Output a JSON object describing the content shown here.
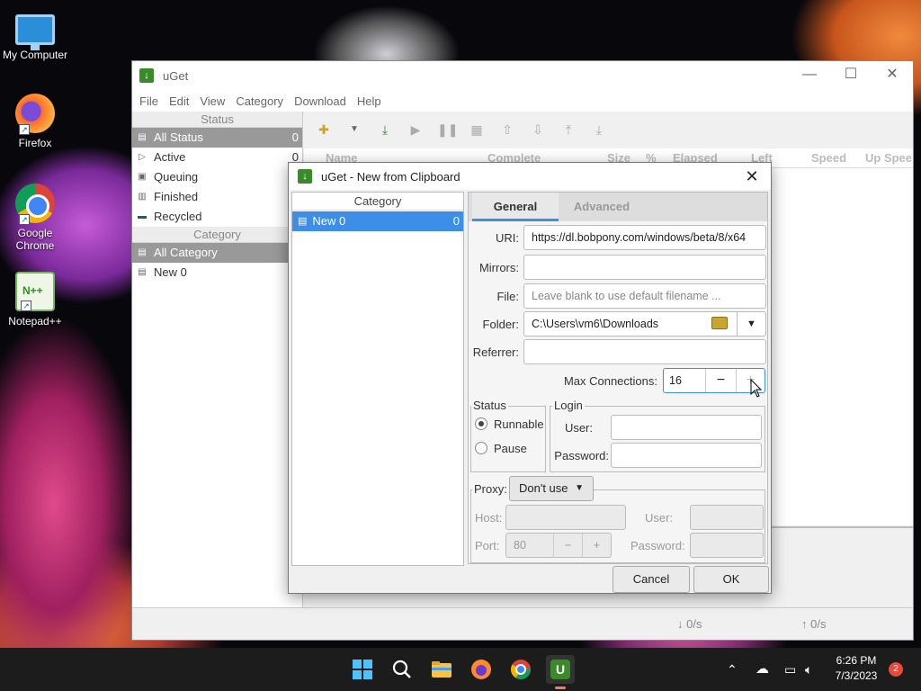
{
  "desktop": {
    "icons": [
      {
        "label": "My Computer"
      },
      {
        "label": "Firefox"
      },
      {
        "label": "Google Chrome"
      },
      {
        "label": "Notepad++"
      }
    ]
  },
  "main_window": {
    "title": "uGet",
    "menu": [
      "File",
      "Edit",
      "View",
      "Category",
      "Download",
      "Help"
    ],
    "status_header": "Status",
    "status_items": [
      {
        "label": "All Status",
        "count": "0"
      },
      {
        "label": "Active",
        "count": "0"
      },
      {
        "label": "Queuing",
        "count": ""
      },
      {
        "label": "Finished",
        "count": ""
      },
      {
        "label": "Recycled",
        "count": ""
      }
    ],
    "category_header": "Category",
    "category_items": [
      {
        "label": "All Category"
      },
      {
        "label": "New 0"
      }
    ],
    "columns": [
      "Name",
      "Complete",
      "Size",
      "%",
      "Elapsed",
      "Left",
      "Speed",
      "Up Spee"
    ],
    "statusbar": {
      "down": "↓ 0/s",
      "up": "↑ 0/s"
    }
  },
  "dialog": {
    "title": "uGet - New from Clipboard",
    "category_header": "Category",
    "category_item": {
      "label": "New 0",
      "count": "0"
    },
    "tabs": [
      "General",
      "Advanced"
    ],
    "uri_label": "URI:",
    "uri_value": "https://dl.bobpony.com/windows/beta/8/x64",
    "mirrors_label": "Mirrors:",
    "file_label": "File:",
    "file_placeholder": "Leave blank to use default filename ...",
    "folder_label": "Folder:",
    "folder_value": "C:\\Users\\vm6\\Downloads",
    "referrer_label": "Referrer:",
    "max_conn_label": "Max Connections:",
    "max_conn_value": "16",
    "status_group": "Status",
    "runnable_label": "Runnable",
    "pause_label": "Pause",
    "login_group": "Login",
    "user_label": "User:",
    "password_label": "Password:",
    "proxy_label": "Proxy:",
    "proxy_value": "Don't use",
    "host_label": "Host:",
    "port_label": "Port:",
    "port_value": "80",
    "proxy_user_label": "User:",
    "proxy_password_label": "Password:",
    "cancel_label": "Cancel",
    "ok_label": "OK"
  },
  "taskbar": {
    "time": "6:26 PM",
    "date": "7/3/2023",
    "notifications": "2"
  }
}
